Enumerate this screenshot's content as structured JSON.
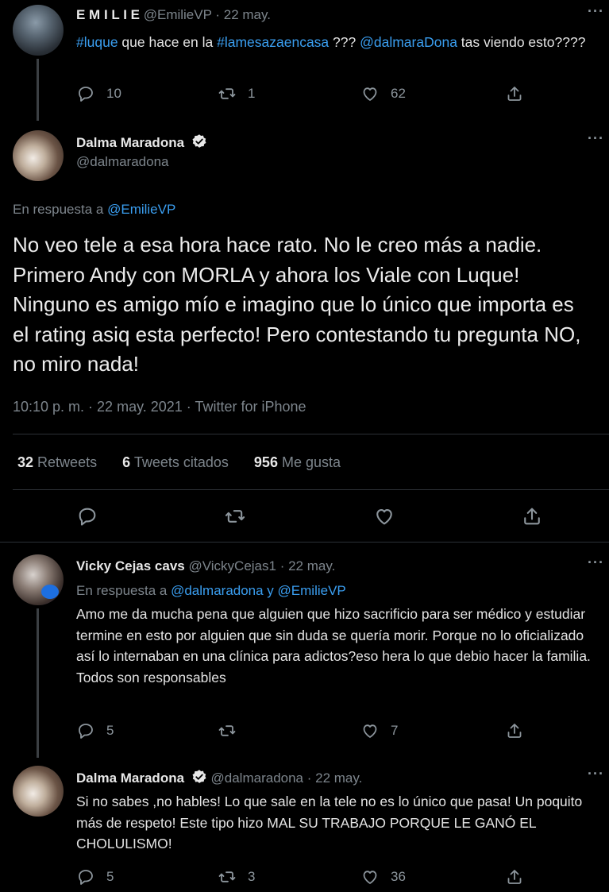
{
  "tweet1": {
    "display_name": "E M I L I E",
    "handle": "@EmilieVP",
    "date": "· 22 may.",
    "text_parts": [
      "#luque",
      " que hace en la ",
      "#lamesazaencasa",
      " ??? ",
      "@dalmaraDona",
      " tas viendo esto????"
    ],
    "replies": "10",
    "retweets": "1",
    "likes": "62"
  },
  "main": {
    "display_name": "Dalma Maradona",
    "handle": "@dalmaradona",
    "reply_to_label": "En respuesta a",
    "reply_to_handle": "@EmilieVP",
    "text": "No veo tele a esa hora hace rato. No le creo más a nadie. Primero Andy con MORLA y ahora los Viale con Luque! Ninguno es amigo mío e imagino que lo único que importa es el rating asiq esta perfecto! Pero contestando tu pregunta NO, no miro nada!",
    "meta": "10:10 p. m. · 22 may. 2021 · Twitter for iPhone",
    "retweets_count": "32",
    "retweets_label": "Retweets",
    "quotes_count": "6",
    "quotes_label": "Tweets citados",
    "likes_count": "956",
    "likes_label": "Me gusta"
  },
  "reply1": {
    "display_name": "Vicky Cejas cavs",
    "handle": "@VickyCejas1",
    "date": "· 22 may.",
    "reply_to_label": "En respuesta a",
    "reply_to_handles": "@dalmaradona y @EmilieVP",
    "text": "Amo me da mucha pena que alguien que hizo sacrificio para ser médico y estudiar termine en esto por alguien que sin duda se quería morir. Porque no lo oficializado así lo internaban en una clínica para adictos?eso hera lo que debio hacer la familia. Todos son responsables",
    "replies": "5",
    "retweets": "",
    "likes": "7"
  },
  "reply2": {
    "display_name": "Dalma Maradona",
    "handle": "@dalmaradona",
    "date": "· 22 may.",
    "text": "Si no sabes ,no hables! Lo que sale en la tele no es lo único que pasa! Un poquito más de respeto! Este tipo hizo MAL SU TRABAJO PORQUE LE GANÓ EL CHOLULISMO!",
    "replies": "5",
    "retweets": "3",
    "likes": "36"
  },
  "colors": {
    "background": "#000000",
    "link": "#3a9ef0",
    "muted": "#7d858c"
  }
}
